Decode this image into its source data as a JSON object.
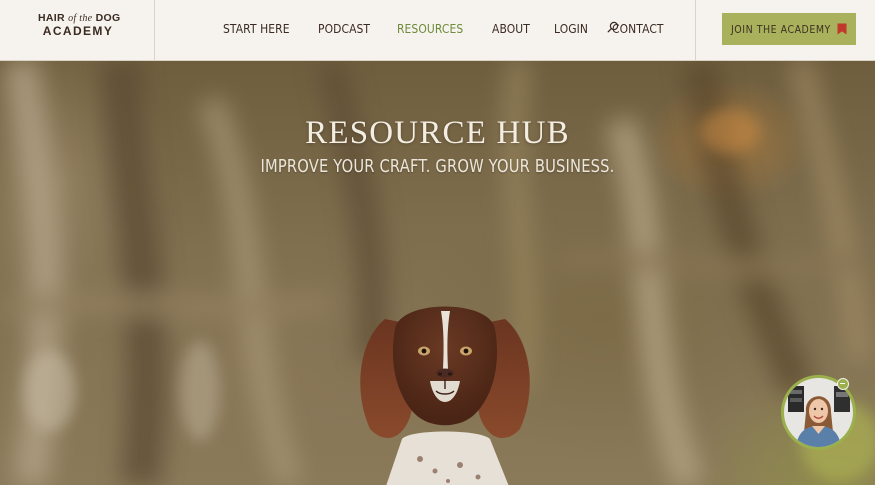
{
  "brand": {
    "logo_part1": "HAIR ",
    "logo_part2": "of the",
    "logo_part3": " DOG",
    "logo_line2": "ACADEMY"
  },
  "nav": {
    "items": [
      {
        "label": "START HERE",
        "active": false
      },
      {
        "label": "PODCAST",
        "active": false
      },
      {
        "label": "RESOURCES",
        "active": true
      },
      {
        "label": "ABOUT",
        "active": false
      },
      {
        "label": "LOGIN",
        "active": false
      },
      {
        "label": "CONTACT",
        "active": false
      }
    ],
    "search_icon": "search-icon"
  },
  "cta": {
    "label": "JOIN THE ACADEMY",
    "icon": "bookmark-icon",
    "background": "#a9b15c",
    "icon_color": "#c0392b"
  },
  "hero": {
    "title": "RESOURCE HUB",
    "subtitle": "IMPROVE YOUR CRAFT. GROW YOUR BUSINESS."
  },
  "colors": {
    "accent_active": "#6f8a3a",
    "text_dark": "#3b2b22",
    "header_bg": "#f6f3ee",
    "chat_ring": "#9bb04c"
  },
  "chat_widget": {
    "icon": "video-chat-avatar",
    "minimize_icon": "minimize-icon"
  }
}
